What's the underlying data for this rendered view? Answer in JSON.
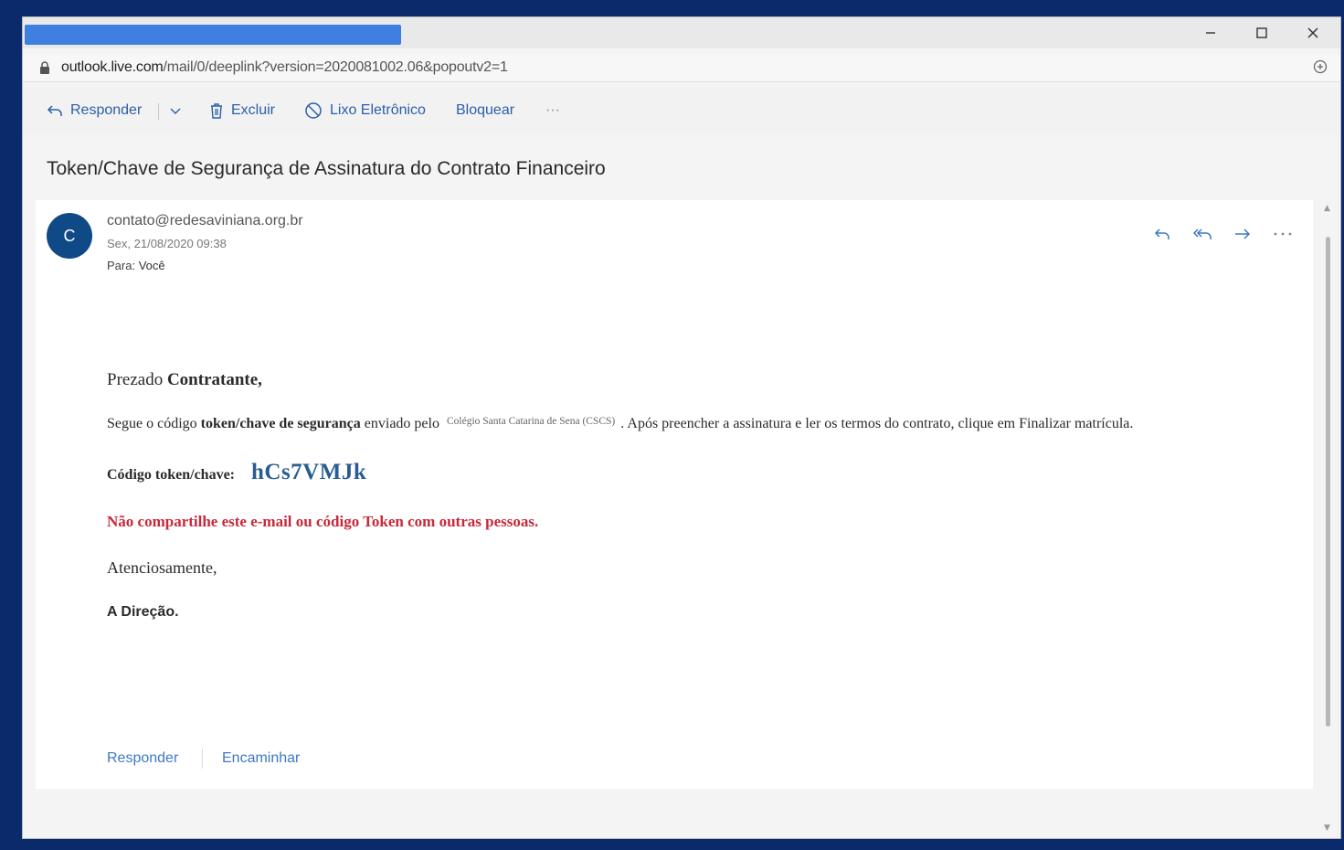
{
  "window": {
    "url_domain": "outlook.live.com",
    "url_path": "/mail/0/deeplink?version=2020081002.06&popoutv2=1",
    "minimize_icon": "minimize-icon",
    "maximize_icon": "maximize-icon",
    "close_icon": "close-icon"
  },
  "toolbar": {
    "reply_label": "Responder",
    "delete_label": "Excluir",
    "junk_label": "Lixo Eletrônico",
    "block_label": "Bloquear",
    "more_label": "···"
  },
  "message": {
    "subject": "Token/Chave de Segurança de Assinatura do Contrato Financeiro",
    "avatar_initial": "C",
    "sender": "contato@redesaviniana.org.br",
    "date": "Sex, 21/08/2020 09:38",
    "to_label": "Para:",
    "to_value": "Você",
    "body": {
      "greeting_prefix": "Prezado ",
      "greeting_name": "Contratante,",
      "line2_a": "Segue o código ",
      "line2_b": "token/chave de segurança",
      "line2_c": " enviado pelo",
      "line2_school": "Colégio Santa Catarina de Sena (CSCS)",
      "line2_d": ". Após preencher a assinatura e ler os termos do contrato, clique em Finalizar matrícula.",
      "token_label": "Código token/chave:",
      "token_value": "hCs7VMJk",
      "warning": "Não compartilhe este e-mail ou código Token com outras pessoas.",
      "regards": "Atenciosamente,",
      "signature": "A Direção."
    },
    "footer_reply": "Responder",
    "footer_forward": "Encaminhar"
  },
  "colors": {
    "accent": "#2b5fa8",
    "avatar_bg": "#0f4a86",
    "token": "#2a5c93",
    "warning": "#c8283a",
    "title_highlight": "#3f7fe0"
  }
}
